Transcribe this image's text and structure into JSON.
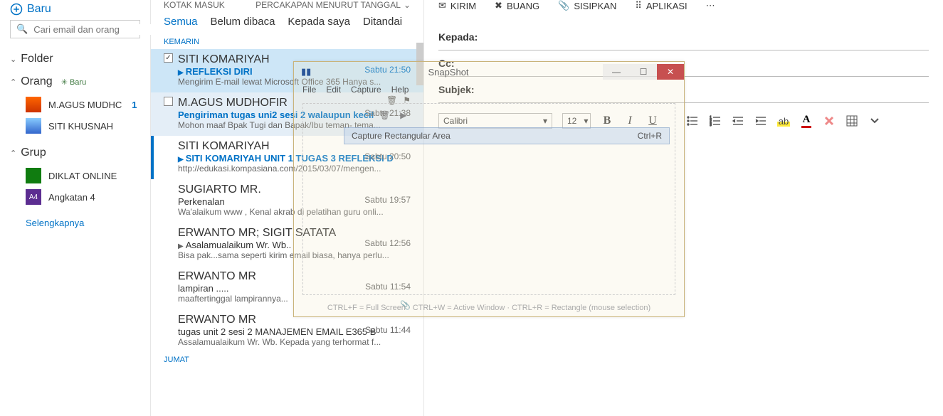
{
  "sidebar": {
    "new_label": "Baru",
    "search_placeholder": "Cari email dan orang",
    "sections": {
      "folder": "Folder",
      "people": "Orang",
      "people_new": "✳ Baru",
      "group": "Grup"
    },
    "people": [
      {
        "name": "M.AGUS MUDHC",
        "count": "1"
      },
      {
        "name": "SITI KHUSNAH",
        "count": ""
      }
    ],
    "groups": [
      {
        "tile": "",
        "name": "DIKLAT ONLINE",
        "cls": "green"
      },
      {
        "tile": "A4",
        "name": "Angkatan 4",
        "cls": "purple"
      }
    ],
    "more": "Selengkapnya"
  },
  "list": {
    "inbox_label": "KOTAK MASUK",
    "sort_label": "PERCAKAPAN MENURUT TANGGAL",
    "filters": {
      "all": "Semua",
      "unread": "Belum dibaca",
      "tome": "Kepada saya",
      "flagged": "Ditandai"
    },
    "yesterday": "KEMARIN",
    "friday": "JUMAT",
    "messages": [
      {
        "from": "SITI KOMARIYAH",
        "subject": "REFLEKSI DIRI",
        "preview": "Mengirim E-mail lewat Microsoft Office 365 Hanya s...",
        "time": "Sabtu 21:50",
        "unread": true,
        "checked": true,
        "caret": true
      },
      {
        "from": "M.AGUS MUDHOFIR",
        "subject": "Pengiriman tugas uni2 sesi 2 walaupun kecil",
        "preview": "Mohon maaf Bpak Tugi dan Bapak/Ibu teman- tema...",
        "time": "Sabtu 21:38",
        "unread": true,
        "checked": false,
        "glyphs": true
      },
      {
        "from": "SITI KOMARIYAH",
        "subject": "SITI KOMARIYAH UNIT 1 TUGAS 3 REFLEKSI D",
        "preview": "http://edukasi.kompasiana.com/2015/03/07/mengen...",
        "time": "Sabtu 20:50",
        "unread": true,
        "caret": true,
        "nocheck": true
      },
      {
        "from": "SUGIARTO MR.",
        "subject": "Perkenalan",
        "preview": "Wa'alaikum www , Kenal akrab di pelatihan guru onli...",
        "time": "Sabtu 19:57",
        "nocheck": true
      },
      {
        "from": "ERWANTO MR; SIGIT SATATA",
        "subject": "Asalamualaikum Wr. Wb..",
        "preview": "Bisa pak...sama seperti kirim email biasa, hanya perlu...",
        "time": "Sabtu 12:56",
        "caret": true,
        "nocheck": true
      },
      {
        "from": "ERWANTO MR",
        "subject": "lampiran .....",
        "preview": "maaftertinggal lampirannya...",
        "time": "Sabtu 11:54",
        "attach": true,
        "nocheck": true
      },
      {
        "from": "ERWANTO MR",
        "subject": "tugas unit 2 sesi 2 MANAJEMEN EMAIL E365 B",
        "preview": "Assalamualaikum Wr. Wb.   Kepada yang terhormat f...",
        "time": "Sabtu 11:44",
        "nocheck": true
      }
    ]
  },
  "compose": {
    "actions": {
      "send": "KIRIM",
      "discard": "BUANG",
      "insert": "SISIPKAN",
      "apps": "APLIKASI"
    },
    "to": "Kepada:",
    "cc": "Cc:",
    "subject": "Subjek:",
    "font": "Calibri",
    "size": "12"
  },
  "overlay": {
    "title": "SnapShot",
    "menu": {
      "file": "File",
      "edit": "Edit",
      "capture": "Capture",
      "help": "Help"
    },
    "action": "Capture Rectangular Area",
    "shortcut": "Ctrl+R",
    "footer": "CTRL+F = Full Screen  ·  CTRL+W = Active Window  ·  CTRL+R = Rectangle (mouse selection)"
  }
}
